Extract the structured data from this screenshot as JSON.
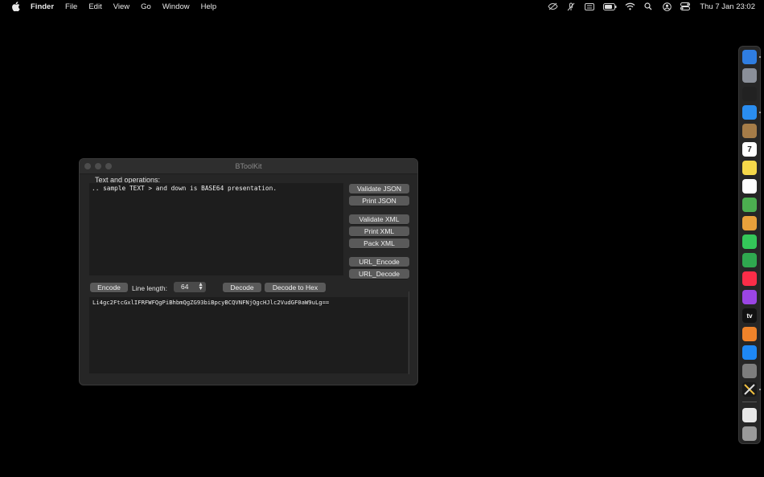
{
  "menubar": {
    "app_name": "Finder",
    "items": [
      "File",
      "Edit",
      "View",
      "Go",
      "Window",
      "Help"
    ],
    "clock": "Thu 7 Jan  23:02",
    "status_icons": [
      "eye-slash-icon",
      "mic-slash-icon",
      "keyboard-icon",
      "battery-icon",
      "wifi-icon",
      "search-icon",
      "user-icon",
      "control-center-icon"
    ]
  },
  "window": {
    "title": "BToolKit",
    "section_label": "Text and operations:",
    "input_text": ".. sample TEXT > and down is BASE64 presentation.",
    "buttons": {
      "validate_json": "Validate JSON",
      "print_json": "Print JSON",
      "validate_xml": "Validate XML",
      "print_xml": "Print XML",
      "pack_xml": "Pack XML",
      "url_encode": "URL_Encode",
      "url_decode": "URL_Decode",
      "encode": "Encode",
      "decode": "Decode",
      "decode_hex": "Decode to Hex"
    },
    "line_length_label": "Line length:",
    "line_length_value": "64",
    "output_text": "Li4gc2FtcGxlIFRFWFQgPiBhbmQgZG93biBpcyBCQVNFNjQgcHJlc2VudGF0aW9uLg=="
  },
  "dock": {
    "apps": [
      {
        "name": "finder-icon",
        "color": "#2f7de1"
      },
      {
        "name": "launchpad-icon",
        "color": "#8a8f99"
      },
      {
        "name": "terminal-icon",
        "color": "#222222"
      },
      {
        "name": "safari-icon",
        "color": "#2a8df0"
      },
      {
        "name": "contacts-icon",
        "color": "#a57c48"
      },
      {
        "name": "calendar-icon",
        "color": "#ffffff"
      },
      {
        "name": "notes-icon",
        "color": "#f5d84a"
      },
      {
        "name": "reminders-icon",
        "color": "#ffffff"
      },
      {
        "name": "maps-icon",
        "color": "#4caf50"
      },
      {
        "name": "photos-icon",
        "color": "#e9a13b"
      },
      {
        "name": "messages-icon",
        "color": "#34c759"
      },
      {
        "name": "numbers-icon",
        "color": "#2fa84f"
      },
      {
        "name": "music-icon",
        "color": "#fa2d48"
      },
      {
        "name": "podcasts-icon",
        "color": "#9b45e4"
      },
      {
        "name": "tv-icon",
        "color": "#111111"
      },
      {
        "name": "books-icon",
        "color": "#f0832a"
      },
      {
        "name": "app-store-icon",
        "color": "#1e88f5"
      },
      {
        "name": "system-preferences-icon",
        "color": "#7d7d7d"
      },
      {
        "name": "btoolkit-icon",
        "color": "#1a1a1a"
      },
      {
        "name": "document-icon",
        "color": "#e8e8e8"
      },
      {
        "name": "trash-icon",
        "color": "#9a9a9a"
      }
    ],
    "calendar_day": "7",
    "tv_label": "tv"
  }
}
